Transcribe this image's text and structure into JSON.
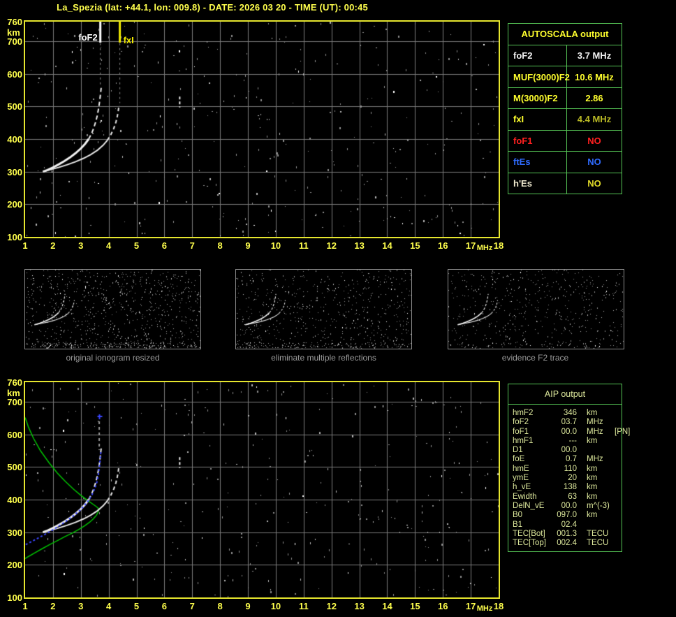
{
  "title": "La_Spezia (lat: +44.1, lon: 009.8) - DATE: 2026 03 20 - TIME (UT): 00:45",
  "colors": {
    "title": "#ffff4d",
    "plot_border": "#e6e62e",
    "grid": "#7a7a7a",
    "panel_border": "#55c455",
    "aip_text": "#dde89c",
    "trace_white": "#f2f2f2",
    "profile_green": "#00c400",
    "restored_blue": "#3a46ff",
    "marker_fof2": "#ffffff",
    "marker_fxi": "#f2ea00"
  },
  "autoscala": {
    "header": "AUTOSCALA output",
    "rows": [
      {
        "label": "foF2",
        "value": "3.7 MHz",
        "label_color": "#f2f2f2",
        "value_color": "#f2f2f2"
      },
      {
        "label": "MUF(3000)F2",
        "value": "10.6 MHz",
        "label_color": "#ffff2e",
        "value_color": "#ffff2e"
      },
      {
        "label": "M(3000)F2",
        "value": "2.86",
        "label_color": "#ffff2e",
        "value_color": "#ffff2e"
      },
      {
        "label": "fxI",
        "value": "4.4 MHz",
        "label_color": "#ffff2e",
        "value_color": "#b9b925"
      },
      {
        "label": "foF1",
        "value": "NO",
        "label_color": "#ff2020",
        "value_color": "#ff2020"
      },
      {
        "label": "ftEs",
        "value": "NO",
        "label_color": "#2f6bff",
        "value_color": "#2f6bff"
      },
      {
        "label": "h'Es",
        "value": "NO",
        "label_color": "#efe9cf",
        "value_color": "#e0da28"
      }
    ]
  },
  "aip": {
    "header": "AIP output",
    "rows": [
      {
        "param": "hmF2",
        "value": "346",
        "unit": "km",
        "note": ""
      },
      {
        "param": "foF2",
        "value": "03.7",
        "unit": "MHz",
        "note": ""
      },
      {
        "param": "foF1",
        "value": "00.0",
        "unit": "MHz",
        "note": "[PN]"
      },
      {
        "param": "hmF1",
        "value": "---",
        "unit": "km",
        "note": ""
      },
      {
        "param": "D1",
        "value": "00.0",
        "unit": "",
        "note": ""
      },
      {
        "param": "foE",
        "value": "0.7",
        "unit": "MHz",
        "note": ""
      },
      {
        "param": "hmE",
        "value": "110",
        "unit": "km",
        "note": ""
      },
      {
        "param": "ymE",
        "value": "20",
        "unit": "km",
        "note": ""
      },
      {
        "param": "h_vE",
        "value": "138",
        "unit": "km",
        "note": ""
      },
      {
        "param": "Ewidth",
        "value": "63",
        "unit": "km",
        "note": ""
      },
      {
        "param": "DelN_vE",
        "value": "00.0",
        "unit": "m^(-3)",
        "note": ""
      },
      {
        "param": "B0",
        "value": "097.0",
        "unit": "km",
        "note": ""
      },
      {
        "param": "B1",
        "value": "02.4",
        "unit": "",
        "note": ""
      },
      {
        "param": "TEC[Bot]",
        "value": "001.3",
        "unit": "TECU",
        "note": ""
      },
      {
        "param": "TEC[Top]",
        "value": "002.4",
        "unit": "TECU",
        "note": ""
      }
    ]
  },
  "chart_data": [
    {
      "id": "main-ionogram",
      "type": "scatter",
      "xlabel": "MHz",
      "ylabel": "km",
      "xlim": [
        1,
        18
      ],
      "ylim": [
        100,
        760
      ],
      "grid": true,
      "axis": {
        "x_ticks": [
          1,
          2,
          3,
          4,
          5,
          6,
          7,
          8,
          9,
          10,
          11,
          12,
          13,
          14,
          15,
          16,
          17,
          18
        ],
        "y_ticks": [
          760,
          700,
          600,
          500,
          400,
          300,
          200,
          100
        ],
        "x_unit": "MHz",
        "y_unit": "km"
      },
      "markers": [
        {
          "name": "foF2",
          "f": 3.7,
          "value_mhz": 3.7,
          "color": "#ffffff",
          "label": "foF2",
          "side": "left"
        },
        {
          "name": "fxI",
          "f": 4.4,
          "value_mhz": 4.4,
          "color": "#f2ea00",
          "label": "fxI",
          "side": "right"
        }
      ],
      "noise": {
        "seed": 11,
        "count": 380
      },
      "series": [
        {
          "name": "o-trace-lower",
          "color": "#f2f2f2",
          "width": 3,
          "points": [
            [
              1.64,
              300
            ],
            [
              1.8,
              305
            ],
            [
              2.0,
              313
            ],
            [
              2.2,
              322
            ],
            [
              2.4,
              332
            ],
            [
              2.6,
              343
            ],
            [
              2.8,
              356
            ],
            [
              3.0,
              371
            ],
            [
              3.15,
              385
            ],
            [
              3.28,
              400
            ]
          ]
        },
        {
          "name": "o-trace-upper",
          "color": "#f2f2f2",
          "width": 2,
          "dash": [
            6,
            4
          ],
          "points": [
            [
              3.28,
              400
            ],
            [
              3.38,
              416
            ],
            [
              3.46,
              433
            ],
            [
              3.53,
              452
            ],
            [
              3.59,
              472
            ],
            [
              3.64,
              495
            ],
            [
              3.68,
              519
            ],
            [
              3.71,
              541
            ],
            [
              3.73,
              557
            ]
          ]
        },
        {
          "name": "x-trace-lower",
          "color": "#e8e8e8",
          "width": 2,
          "points": [
            [
              1.64,
              300
            ],
            [
              1.9,
              306
            ],
            [
              2.2,
              313
            ],
            [
              2.5,
              321
            ],
            [
              2.8,
              330
            ],
            [
              3.1,
              341
            ],
            [
              3.35,
              352
            ],
            [
              3.6,
              366
            ],
            [
              3.8,
              381
            ],
            [
              3.95,
              396
            ]
          ]
        },
        {
          "name": "x-trace-upper",
          "color": "#e8e8e8",
          "width": 2,
          "dash": [
            5,
            4
          ],
          "points": [
            [
              3.95,
              396
            ],
            [
              4.08,
              414
            ],
            [
              4.18,
              432
            ],
            [
              4.26,
              452
            ],
            [
              4.31,
              470
            ],
            [
              4.35,
              490
            ],
            [
              4.37,
              505
            ]
          ]
        },
        {
          "name": "interference-dash",
          "color": "#f0f0f0",
          "width": 2,
          "dash": [
            4,
            3
          ],
          "points": [
            [
              6.55,
              530
            ],
            [
              6.55,
              497
            ]
          ]
        },
        {
          "name": "fof2-search-dash",
          "color": "#8a8a8a",
          "width": 1,
          "dash": [
            3,
            4
          ],
          "points": [
            [
              3.7,
              694
            ],
            [
              3.7,
              562
            ]
          ]
        },
        {
          "name": "fxi-search-dash",
          "color": "#8a8a8a",
          "width": 1,
          "dash": [
            3,
            4
          ],
          "points": [
            [
              4.4,
              694
            ],
            [
              4.4,
              510
            ]
          ]
        }
      ]
    },
    {
      "id": "aip-ionogram",
      "type": "scatter",
      "xlabel": "MHz",
      "ylabel": "km",
      "xlim": [
        1,
        18
      ],
      "ylim": [
        100,
        760
      ],
      "grid": true,
      "axis": {
        "x_ticks": [
          1,
          2,
          3,
          4,
          5,
          6,
          7,
          8,
          9,
          10,
          11,
          12,
          13,
          14,
          15,
          16,
          17,
          18
        ],
        "y_ticks": [
          760,
          700,
          600,
          500,
          400,
          300,
          200,
          100
        ],
        "x_unit": "MHz",
        "y_unit": "km"
      },
      "noise": {
        "seed": 22,
        "count": 340
      },
      "series": [
        {
          "name": "electron-density-profile",
          "color": "#00c400",
          "width": 1.5,
          "points": [
            [
              1.0,
              652
            ],
            [
              1.12,
              622
            ],
            [
              1.3,
              588
            ],
            [
              1.55,
              550
            ],
            [
              1.85,
              514
            ],
            [
              2.15,
              482
            ],
            [
              2.45,
              455
            ],
            [
              2.75,
              431
            ],
            [
              3.0,
              413
            ],
            [
              3.25,
              397
            ],
            [
              3.45,
              385
            ],
            [
              3.58,
              377
            ],
            [
              3.65,
              371
            ],
            [
              3.62,
              362
            ],
            [
              3.56,
              352
            ],
            [
              3.46,
              342
            ],
            [
              3.32,
              331
            ],
            [
              3.14,
              320
            ],
            [
              2.92,
              308
            ],
            [
              2.68,
              297
            ],
            [
              2.42,
              286
            ],
            [
              2.15,
              274
            ],
            [
              1.88,
              262
            ],
            [
              1.6,
              249
            ],
            [
              1.35,
              237
            ],
            [
              1.15,
              227
            ],
            [
              1.0,
              219
            ]
          ]
        },
        {
          "ref": [
            0,
            0
          ]
        },
        {
          "ref": [
            0,
            1
          ]
        },
        {
          "ref": [
            0,
            2
          ]
        },
        {
          "ref": [
            0,
            3
          ]
        },
        {
          "ref": [
            0,
            4
          ]
        },
        {
          "name": "multiple-echo-remnant",
          "color": "#9a9a9a",
          "width": 2,
          "dash": [
            4,
            4
          ],
          "points": [
            [
              3.66,
              640
            ],
            [
              3.66,
              552
            ]
          ]
        },
        {
          "name": "restored-o-trace",
          "color": "#3a46ff",
          "width": 2,
          "dash": [
            3,
            3
          ],
          "points": [
            [
              1.02,
              262
            ],
            [
              1.2,
              270
            ],
            [
              1.4,
              279
            ],
            [
              1.62,
              289
            ],
            [
              1.85,
              300
            ],
            [
              2.08,
              312
            ],
            [
              2.3,
              324
            ],
            [
              2.52,
              337
            ],
            [
              2.74,
              351
            ],
            [
              2.95,
              366
            ],
            [
              3.12,
              381
            ],
            [
              3.27,
              397
            ],
            [
              3.4,
              415
            ],
            [
              3.5,
              434
            ],
            [
              3.58,
              455
            ],
            [
              3.63,
              478
            ],
            [
              3.67,
              503
            ],
            [
              3.7,
              528
            ],
            [
              3.72,
              548
            ]
          ]
        },
        {
          "name": "restored-trace-marker",
          "type": "plus",
          "color": "#3a46ff",
          "points": [
            [
              3.67,
              655
            ]
          ]
        }
      ]
    },
    {
      "id": "thumb-original",
      "type": "scatter",
      "caption": "original ionogram resized",
      "xlim": [
        1,
        13
      ],
      "ylim": [
        100,
        760
      ],
      "grid": false,
      "width_scale": 0.55,
      "dot_small": true,
      "noise": {
        "seed": 3,
        "count": 780,
        "band": 200
      },
      "series": [
        {
          "ref": [
            0,
            0
          ]
        },
        {
          "ref": [
            0,
            1
          ]
        },
        {
          "ref": [
            0,
            2
          ]
        },
        {
          "ref": [
            0,
            3
          ]
        },
        {
          "ref": [
            0,
            4
          ]
        }
      ]
    },
    {
      "id": "thumb-no-multiples",
      "type": "scatter",
      "caption": "eliminate multiple reflections",
      "xlim": [
        1,
        13
      ],
      "ylim": [
        100,
        760
      ],
      "grid": false,
      "width_scale": 0.55,
      "dot_small": true,
      "noise": {
        "seed": 4,
        "count": 560,
        "band": 150
      },
      "series": [
        {
          "ref": [
            0,
            0
          ]
        },
        {
          "ref": [
            0,
            1
          ]
        },
        {
          "ref": [
            0,
            2
          ]
        },
        {
          "ref": [
            0,
            3
          ]
        },
        {
          "ref": [
            0,
            4
          ]
        }
      ]
    },
    {
      "id": "thumb-f2-trace",
      "type": "scatter",
      "caption": "evidence F2 trace",
      "xlim": [
        1,
        13
      ],
      "ylim": [
        100,
        760
      ],
      "grid": false,
      "width_scale": 0.55,
      "dot_small": true,
      "noise": {
        "seed": 5,
        "count": 500,
        "band": 40
      },
      "series": [
        {
          "ref": [
            0,
            0
          ]
        },
        {
          "ref": [
            0,
            1
          ]
        },
        {
          "ref": [
            0,
            2
          ]
        },
        {
          "ref": [
            0,
            3
          ]
        }
      ]
    }
  ]
}
